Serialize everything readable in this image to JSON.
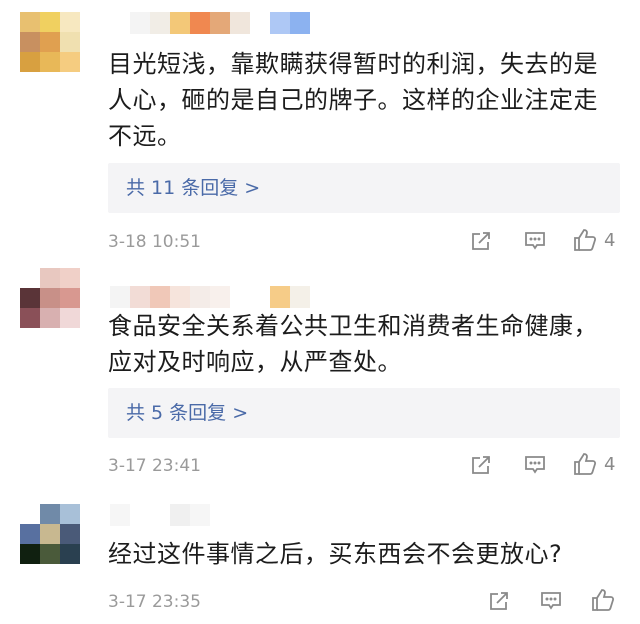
{
  "comments": [
    {
      "text": "目光短浅，靠欺瞒获得暂时的利润，失去的是人心，砸的是自己的牌子。这样的企业注定走不远。",
      "replies_label": "共 11 条回复 >",
      "timestamp": "3-18 10:51",
      "likes": "4",
      "avatar_colors": [
        "#e8c070",
        "#f0d060",
        "#f7e8c0",
        "#c89060",
        "#e0a050",
        "#f0e0b0",
        "#d8a040",
        "#e8b858",
        "#f5cc80"
      ],
      "name_colors": [
        "#ffffff",
        "#f4f4f4",
        "#f1ede6",
        "#f3c878",
        "#f08850",
        "#e4a878",
        "#f0e6dc",
        "#ffffff",
        "#aec8f5",
        "#8cb2f0"
      ]
    },
    {
      "text": "食品安全关系着公共卫生和消费者生命健康，应对及时响应，从严查处。",
      "replies_label": "共 5 条回复 >",
      "timestamp": "3-17 23:41",
      "likes": "4",
      "avatar_colors": [
        "#ffffff",
        "#e8c8c0",
        "#f0d0c8",
        "#5a3438",
        "#c89088",
        "#d89890",
        "#8a5058",
        "#d8b0b0",
        "#f0d8d8"
      ],
      "name_colors": [
        "#f4f4f4",
        "#f2dcd6",
        "#f0c8b8",
        "#f6e4dc",
        "#f4ece8",
        "#f8f0ec",
        "#ffffff",
        "#ffffff",
        "#f6cc88",
        "#f4f0e8"
      ]
    },
    {
      "text": "经过这件事情之后，买东西会不会更放心?",
      "replies_label": "",
      "timestamp": "3-17 23:35",
      "likes": "",
      "avatar_colors": [
        "#ffffff",
        "#708aa8",
        "#a8c0d8",
        "#5870a0",
        "#c8b890",
        "#4a5a78",
        "#102010",
        "#4a5a3a",
        "#2a4050"
      ],
      "name_colors": [
        "#f6f6f6",
        "#ffffff",
        "#ffffff",
        "#f0f0f0",
        "#f6f6f6",
        "#ffffff",
        "#ffffff",
        "#ffffff",
        "#ffffff",
        "#ffffff"
      ]
    }
  ],
  "icons": {
    "share": "share-icon",
    "reply": "comment-icon",
    "like": "thumbs-up-icon"
  }
}
